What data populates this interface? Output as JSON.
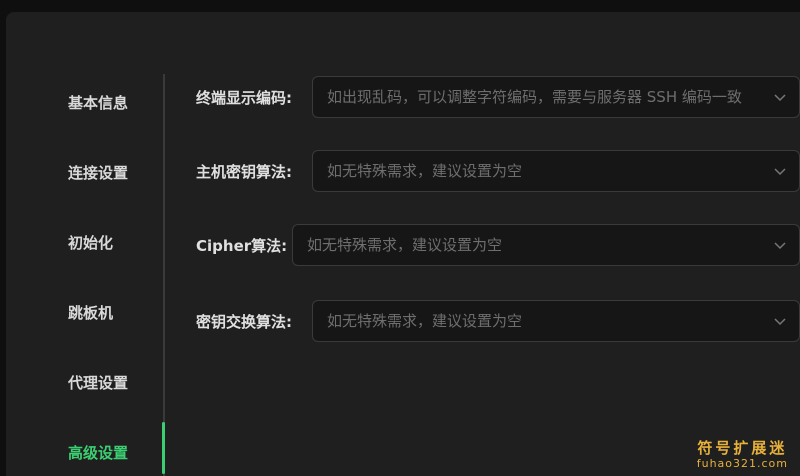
{
  "sidebar": {
    "items": [
      {
        "label": "基本信息"
      },
      {
        "label": "连接设置"
      },
      {
        "label": "初始化"
      },
      {
        "label": "跳板机"
      },
      {
        "label": "代理设置"
      },
      {
        "label": "高级设置",
        "active": true
      }
    ]
  },
  "form": {
    "encoding": {
      "label": "终端显示编码:",
      "placeholder": "如出现乱码，可以调整字符编码，需要与服务器 SSH 编码一致"
    },
    "host_key": {
      "label": "主机密钥算法:",
      "placeholder": "如无特殊需求，建议设置为空"
    },
    "cipher": {
      "label": "Cipher算法:",
      "placeholder": "如无特殊需求，建议设置为空"
    },
    "kex": {
      "label": "密钥交换算法:",
      "placeholder": "如无特殊需求，建议设置为空"
    }
  },
  "watermark": {
    "title": "符号扩展迷",
    "subtitle": "fuhao321.com"
  },
  "colors": {
    "accent": "#3ccf72",
    "panel": "#1f1f1f",
    "watermark": "#e8b13a"
  }
}
